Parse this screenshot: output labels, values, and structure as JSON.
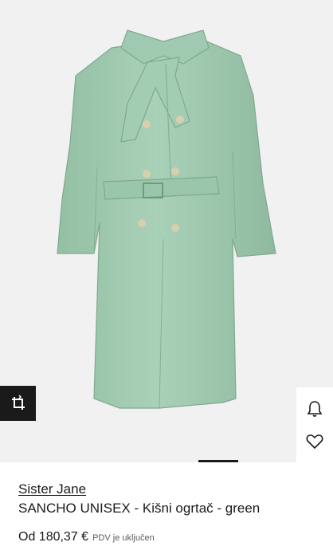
{
  "product": {
    "brand": "Sister Jane",
    "name": "SANCHO UNISEX - Kišni ogrtač - green",
    "price": "Od 180,37 €",
    "vat_note": "PDV je uključen"
  },
  "icons": {
    "ar": "crop-rotate-icon",
    "notify": "bell-icon",
    "wishlist": "heart-icon"
  },
  "colors": {
    "coat": "#a7cfb6",
    "background": "#f1f1f1",
    "text": "#1a1a1a"
  },
  "gallery": {
    "active_image_fraction_start": 0.6
  }
}
